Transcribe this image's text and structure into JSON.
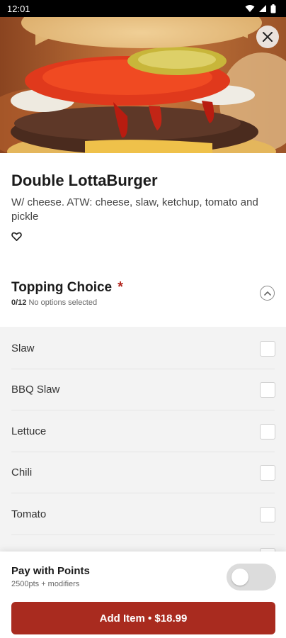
{
  "status_bar": {
    "time": "12:01"
  },
  "item": {
    "title": "Double LottaBurger",
    "description": "W/ cheese. ATW: cheese, slaw, ketchup, tomato and pickle"
  },
  "topping_section": {
    "title": "Topping Choice",
    "required_mark": "*",
    "count": "0/12",
    "status": "No options selected"
  },
  "options": [
    {
      "label": "Slaw",
      "checked": false
    },
    {
      "label": "BBQ Slaw",
      "checked": false
    },
    {
      "label": "Lettuce",
      "checked": false
    },
    {
      "label": "Chili",
      "checked": false
    },
    {
      "label": "Tomato",
      "checked": false
    }
  ],
  "points": {
    "title": "Pay with Points",
    "subtitle": "2500pts + modifiers",
    "enabled": false
  },
  "add_button": {
    "label": "Add Item • $18.99"
  },
  "colors": {
    "accent": "#a92b1f",
    "required": "#b3261e"
  },
  "icons": {
    "close": "close-icon",
    "favorite": "heart-outline-icon",
    "collapse": "chevron-up-icon"
  }
}
